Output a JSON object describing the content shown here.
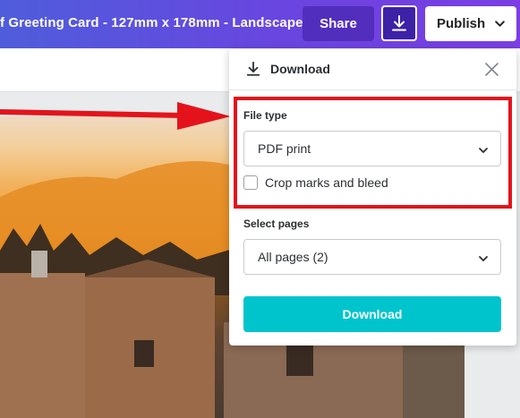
{
  "header": {
    "doc_title": "f Greeting Card - 127mm x 178mm - Landscape",
    "share_label": "Share",
    "publish_label": "Publish",
    "download_icon": "download-icon"
  },
  "download_panel": {
    "title": "Download",
    "close_icon": "close-icon",
    "file_type": {
      "label": "File type",
      "selected": "PDF print"
    },
    "crop_marks": {
      "label": "Crop marks and bleed",
      "checked": false
    },
    "select_pages": {
      "label": "Select pages",
      "selected": "All pages (2)"
    },
    "download_button": "Download"
  },
  "colors": {
    "accent": "#00c4cc",
    "highlight": "#e4131b",
    "header_gradient_start": "#4f5ddb",
    "header_gradient_end": "#7a3ee2"
  }
}
